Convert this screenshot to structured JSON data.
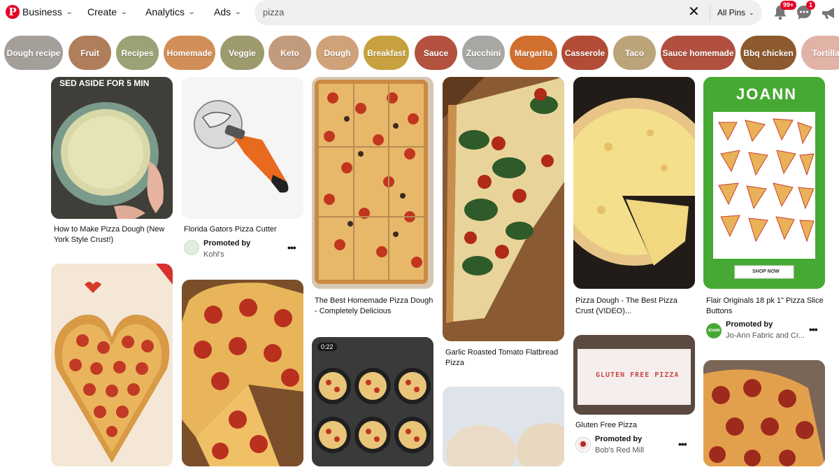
{
  "header": {
    "logo_letter": "P",
    "nav": [
      {
        "label": "Business"
      },
      {
        "label": "Create"
      },
      {
        "label": "Analytics"
      },
      {
        "label": "Ads"
      }
    ],
    "search": {
      "value": "pizza"
    },
    "filter_label": "All Pins",
    "notifications_badge": "99+",
    "messages_badge": "1"
  },
  "chips": [
    {
      "label": "Dough recipe",
      "color": "#a59f9a"
    },
    {
      "label": "Fruit",
      "color": "#b07e5a"
    },
    {
      "label": "Recipes",
      "color": "#9aa276"
    },
    {
      "label": "Homemade",
      "color": "#d18e56"
    },
    {
      "label": "Veggie",
      "color": "#9d9a6e"
    },
    {
      "label": "Keto",
      "color": "#c29a7c"
    },
    {
      "label": "Dough",
      "color": "#cfa27a"
    },
    {
      "label": "Breakfast",
      "color": "#c6a13d"
    },
    {
      "label": "Sauce",
      "color": "#b3523f"
    },
    {
      "label": "Zucchini",
      "color": "#a9a7a3"
    },
    {
      "label": "Margarita",
      "color": "#d16f2e"
    },
    {
      "label": "Casserole",
      "color": "#b24c37"
    },
    {
      "label": "Taco",
      "color": "#bba47a"
    },
    {
      "label": "Sauce homemade",
      "color": "#b1503f"
    },
    {
      "label": "Bbq chicken",
      "color": "#8c5a2e"
    },
    {
      "label": "Tortilla",
      "color": "#e1b2a6"
    }
  ],
  "pins": {
    "pin1": {
      "overlay_text": "SED ASIDE FOR 5 MIN",
      "title": "How to Make Pizza Dough (New York Style Crust!)"
    },
    "pin2": {
      "title": "Florida Gators Pizza Cutter",
      "promoted_label": "Promoted by",
      "promoter": "Kohl's"
    },
    "pin3": {
      "title": "The Best Homemade Pizza Dough - Completely Delicious"
    },
    "pin4": {
      "title": "Garlic Roasted Tomato Flatbread Pizza"
    },
    "pin5": {
      "title": "Pizza Dough - The Best Pizza Crust (VIDEO)..."
    },
    "pin6": {
      "brand_text": "JOANN",
      "button_text": "SHOP NOW",
      "title": "Flair Originals 18 pk 1\" Pizza Slice Buttons",
      "promoted_label": "Promoted by",
      "promoter": "Jo-Ann Fabric and Cr...",
      "avatar_text": "JOANN"
    },
    "pin7": {
      "overlay_text": "GLUTEN FREE PIZZA",
      "title": "Gluten Free Pizza",
      "promoted_label": "Promoted by",
      "promoter": "Bob's Red Mill"
    },
    "pin8": {
      "duration": "0:22"
    }
  }
}
